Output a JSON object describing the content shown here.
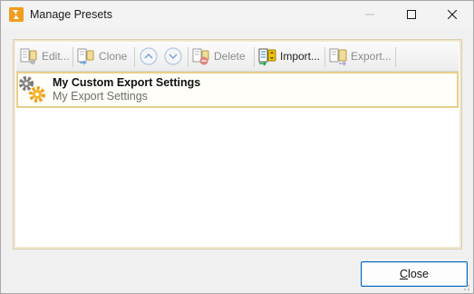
{
  "window": {
    "title": "Manage Presets",
    "accent": "#0067c0"
  },
  "toolbar": {
    "edit_label": "Edit...",
    "clone_label": "Clone",
    "move_up_icon": "chevron-up-circle",
    "move_down_icon": "chevron-down-circle",
    "delete_label": "Delete",
    "import_label": "Import...",
    "export_label": "Export..."
  },
  "presets": {
    "items": [
      {
        "title": "My Custom Export Settings",
        "subtitle": "My Export Settings",
        "icon": "gears-icon",
        "selected": true
      }
    ]
  },
  "footer": {
    "close_label_prefix": "",
    "close_label_accel": "C",
    "close_label_rest": "lose"
  }
}
